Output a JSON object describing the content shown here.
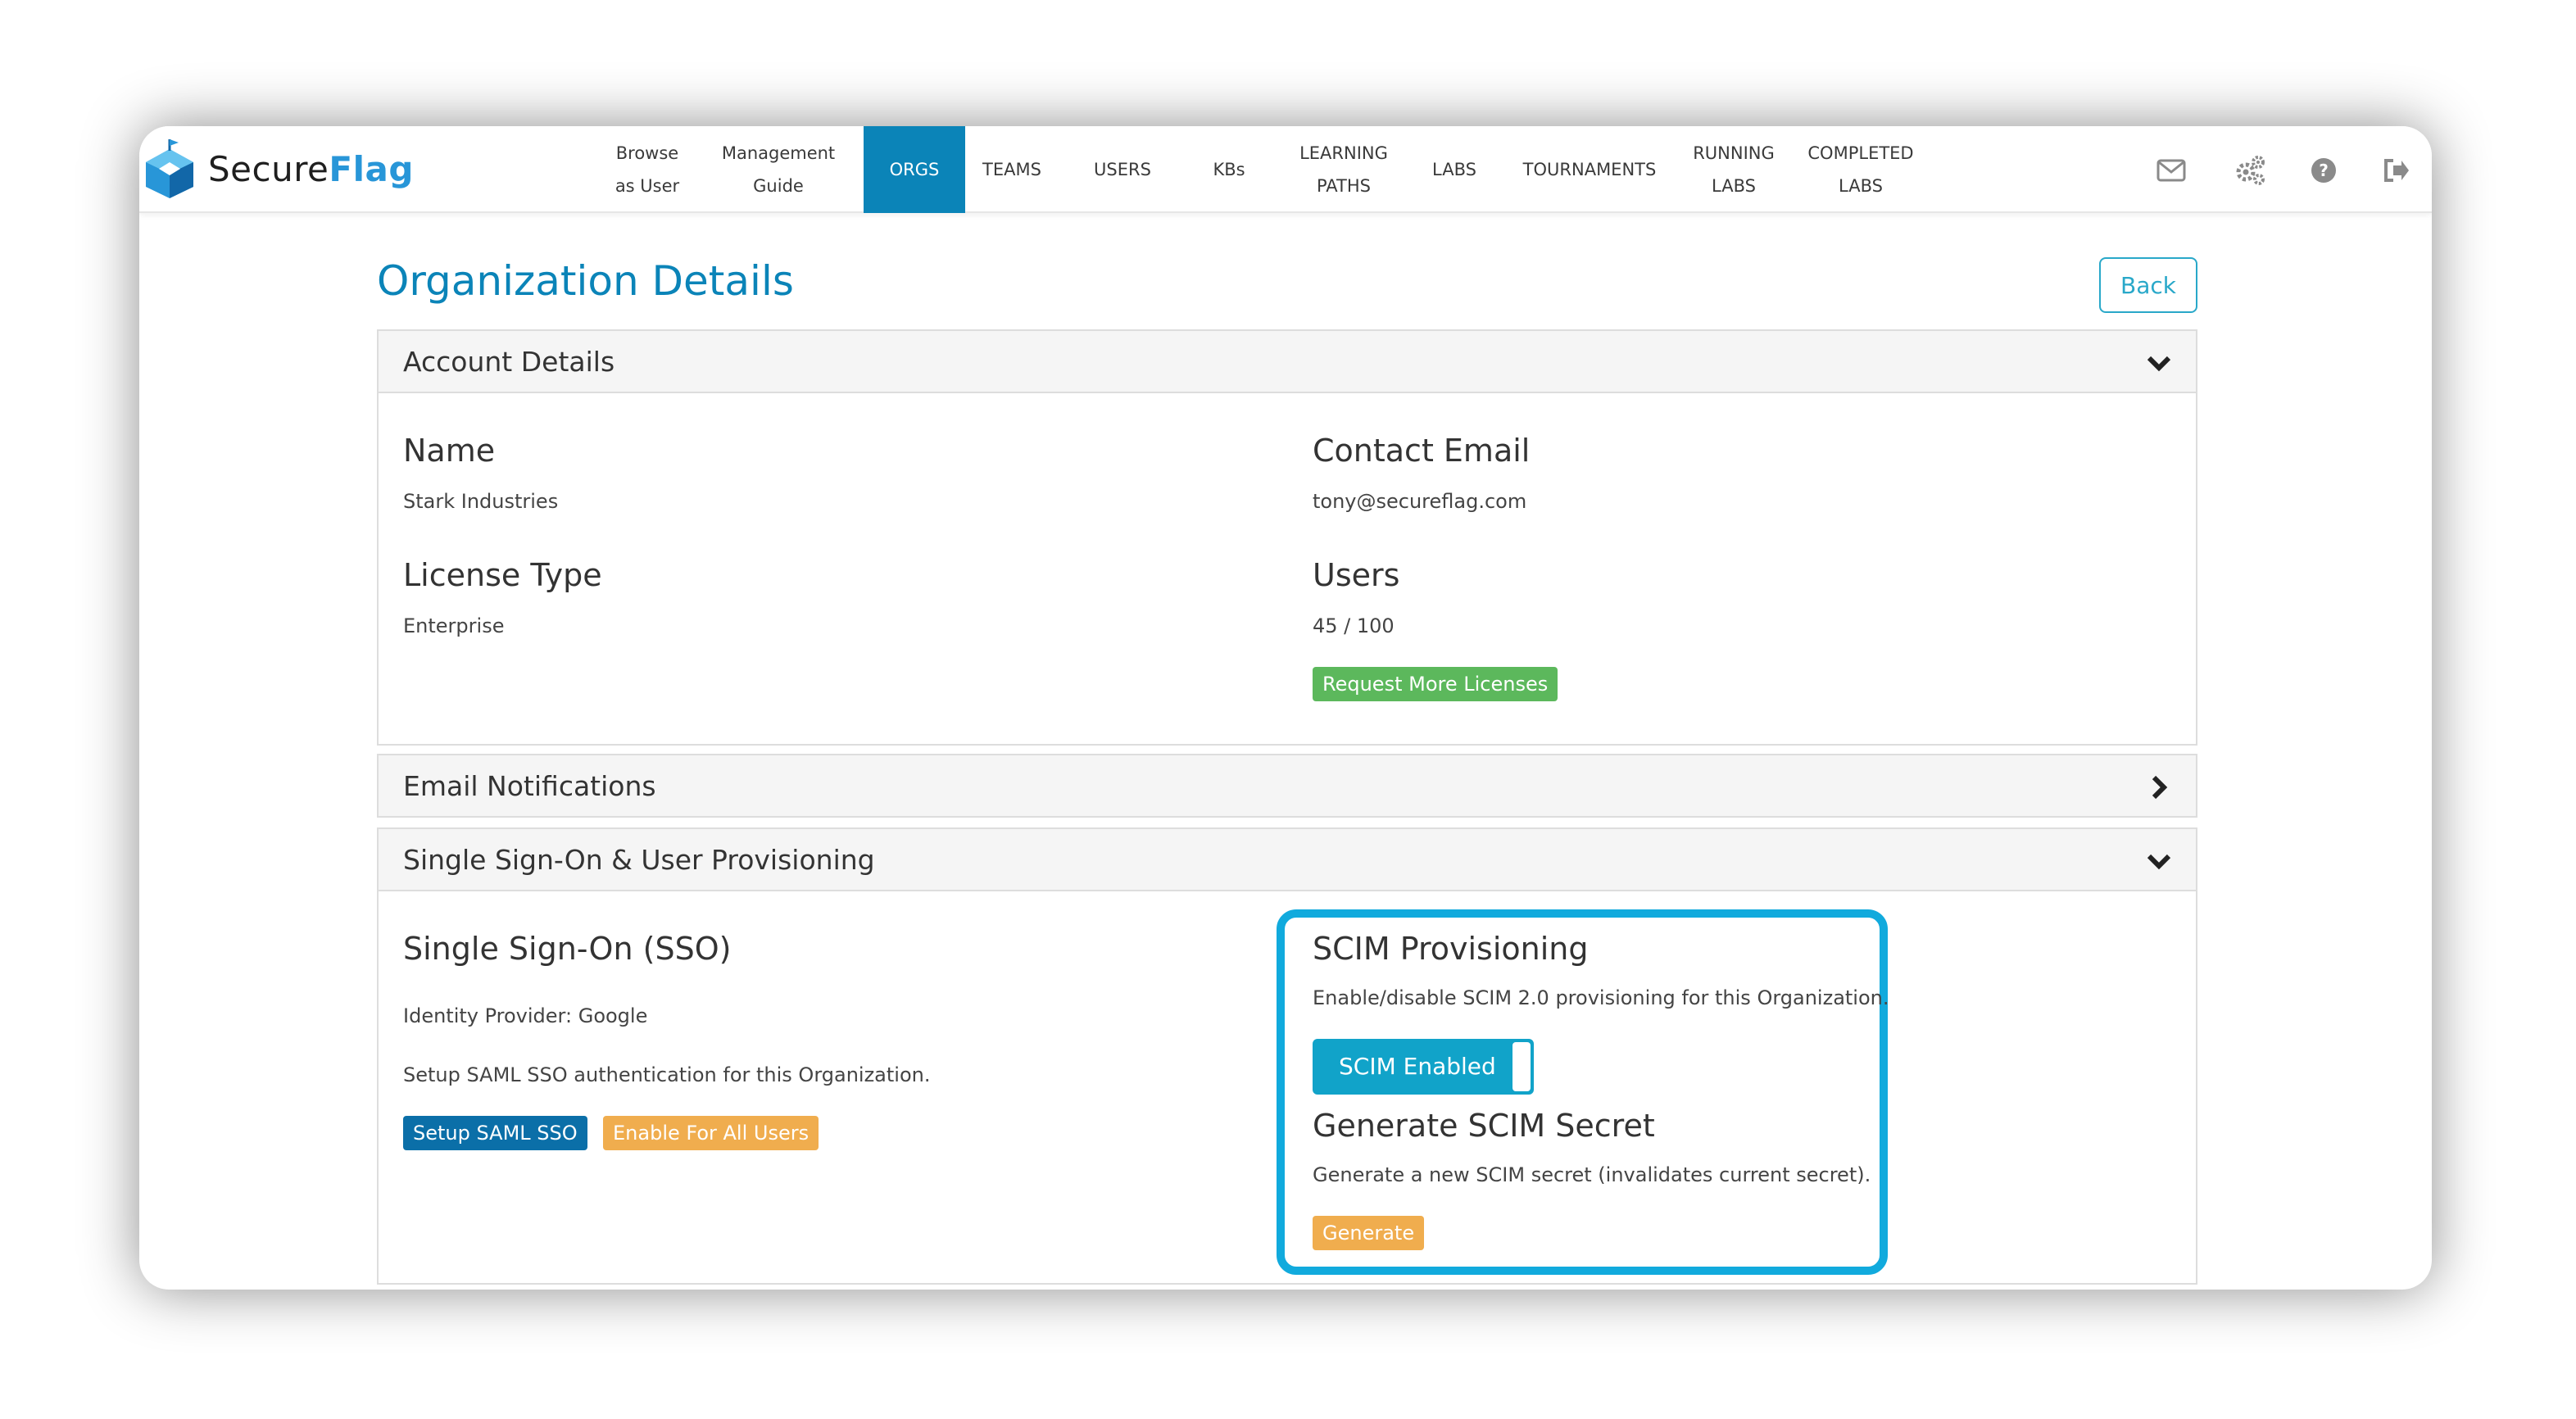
{
  "brand": {
    "part1": "Secure",
    "part2": "Flag"
  },
  "nav": {
    "browse_line1": "Browse",
    "browse_line2": "as User",
    "guide_line1": "Management",
    "guide_line2": "Guide",
    "orgs": "ORGS",
    "teams": "TEAMS",
    "users": "USERS",
    "kbs": "KBs",
    "learning_line1": "LEARNING",
    "learning_line2": "PATHS",
    "labs": "LABS",
    "tournaments": "TOURNAMENTS",
    "running_line1": "RUNNING",
    "running_line2": "LABS",
    "completed_line1": "COMPLETED",
    "completed_line2": "LABS",
    "active": "ORGS",
    "icons": [
      "envelope-icon",
      "gears-icon",
      "help-icon",
      "logout-icon"
    ]
  },
  "page": {
    "title": "Organization Details",
    "back_label": "Back"
  },
  "account": {
    "header": "Account Details",
    "name_label": "Name",
    "name_value": "Stark Industries",
    "email_label": "Contact Email",
    "email_value": "tony@secureflag.com",
    "license_label": "License Type",
    "license_value": "Enterprise",
    "users_label": "Users",
    "users_value": "45 / 100",
    "request_button": "Request More Licenses"
  },
  "notifications": {
    "header": "Email Notifications"
  },
  "sso_section": {
    "header": "Single Sign-On & User Provisioning",
    "sso_title": "Single Sign-On (SSO)",
    "identity_provider": "Identity Provider: Google",
    "setup_text": "Setup SAML SSO authentication for this Organization.",
    "setup_button": "Setup SAML SSO",
    "enable_button": "Enable For All Users",
    "scim_title": "SCIM Provisioning",
    "scim_text": "Enable/disable SCIM 2.0 provisioning for this Organization.",
    "scim_toggle": "SCIM Enabled",
    "secret_title": "Generate SCIM Secret",
    "secret_text": "Generate a new SCIM secret (invalidates current secret).",
    "generate_button": "Generate"
  },
  "colors": {
    "primary": "#0b84b8",
    "accent": "#11aadd",
    "success": "#5cb85c",
    "warning": "#f0ad4e",
    "button_dark": "#0b6fa8"
  }
}
